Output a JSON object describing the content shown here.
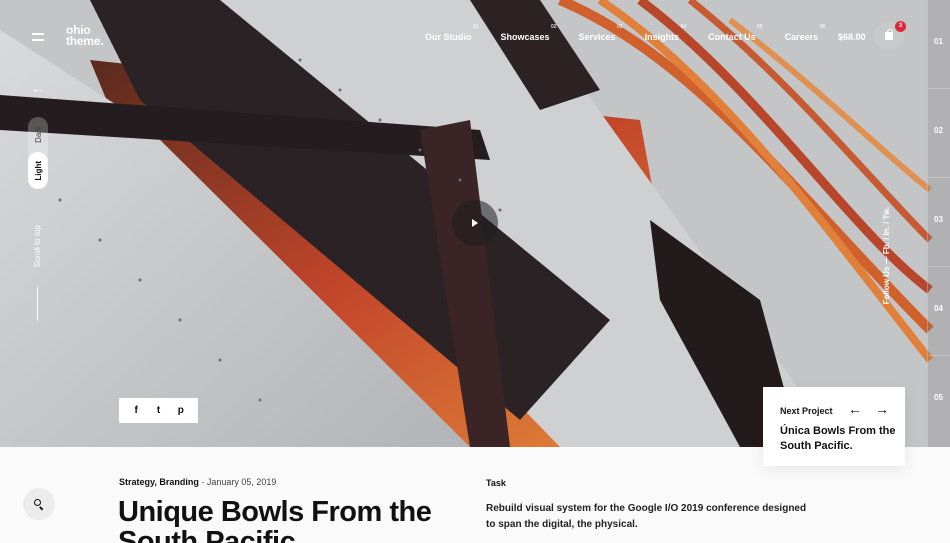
{
  "header": {
    "logo": "ohio\ntheme.",
    "nav": [
      {
        "num": "01",
        "label": "Our Studio"
      },
      {
        "num": "02",
        "label": "Showcases"
      },
      {
        "num": "03",
        "label": "Services"
      },
      {
        "num": "04",
        "label": "Insights"
      },
      {
        "num": "05",
        "label": "Contact Us"
      },
      {
        "num": "06",
        "label": "Careers"
      }
    ],
    "cart_total": "$68.00",
    "cart_count": "3"
  },
  "left_rail": {
    "back_icon": "arrow-left-icon",
    "mode_dark": "Dark",
    "mode_light": "Light",
    "scroll_to_top": "Scroll to top"
  },
  "hero": {
    "play_icon": "play-icon",
    "follow_us": "Follow Us — Fb. / In. / Tw."
  },
  "pager": [
    "01",
    "02",
    "03",
    "04",
    "05"
  ],
  "share": {
    "facebook": "f",
    "twitter": "t",
    "pinterest": "p"
  },
  "next_project": {
    "label": "Next Project",
    "prev_arrow": "←",
    "next_arrow": "→",
    "title": "Única Bowls From the South Pacific."
  },
  "article": {
    "categories": "Strategy, Branding",
    "separator": " · ",
    "date": "January 05, 2019",
    "title": "Unique Bowls From the South Pacific.",
    "task_heading": "Task",
    "task_body": "Rebuild visual system for the Google I/O 2019 conference designed to span the digital, the physical."
  },
  "colors": {
    "accent_badge": "#e0293a",
    "text_dark": "#111111",
    "background": "#fafafa"
  }
}
